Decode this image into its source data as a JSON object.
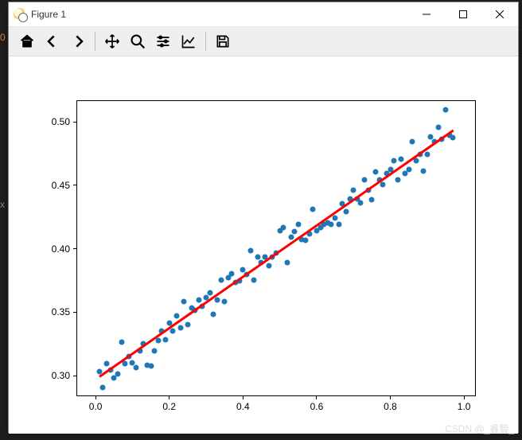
{
  "window": {
    "title": "Figure 1",
    "buttons": {
      "minimize": "Minimize",
      "maximize": "Maximize",
      "close": "Close"
    }
  },
  "toolbar": {
    "home": "Home",
    "back": "Back",
    "forward": "Forward",
    "pan": "Pan",
    "zoom": "Zoom",
    "configure": "Configure subplots",
    "edit": "Edit axis",
    "save": "Save figure"
  },
  "watermark": "CSDN @_睿智_",
  "chart_data": {
    "type": "scatter+line",
    "xlabel": "",
    "ylabel": "",
    "xlim": [
      -0.05,
      1.03
    ],
    "ylim": [
      0.285,
      0.517
    ],
    "xticks": [
      0.0,
      0.2,
      0.4,
      0.6,
      0.8,
      1.0
    ],
    "yticks": [
      0.3,
      0.35,
      0.4,
      0.45,
      0.5
    ],
    "line": {
      "x": [
        0.01,
        0.97
      ],
      "y": [
        0.3,
        0.494
      ],
      "color": "#ff0000"
    },
    "scatter": {
      "color": "#1f77b4",
      "points": [
        [
          0.01,
          0.304
        ],
        [
          0.02,
          0.291
        ],
        [
          0.03,
          0.31
        ],
        [
          0.04,
          0.305
        ],
        [
          0.05,
          0.299
        ],
        [
          0.06,
          0.302
        ],
        [
          0.07,
          0.327
        ],
        [
          0.08,
          0.31
        ],
        [
          0.09,
          0.316
        ],
        [
          0.1,
          0.311
        ],
        [
          0.11,
          0.307
        ],
        [
          0.12,
          0.32
        ],
        [
          0.13,
          0.326
        ],
        [
          0.14,
          0.309
        ],
        [
          0.15,
          0.308
        ],
        [
          0.16,
          0.32
        ],
        [
          0.17,
          0.328
        ],
        [
          0.18,
          0.336
        ],
        [
          0.19,
          0.329
        ],
        [
          0.2,
          0.342
        ],
        [
          0.21,
          0.336
        ],
        [
          0.22,
          0.348
        ],
        [
          0.23,
          0.338
        ],
        [
          0.24,
          0.359
        ],
        [
          0.25,
          0.341
        ],
        [
          0.26,
          0.354
        ],
        [
          0.27,
          0.352
        ],
        [
          0.28,
          0.36
        ],
        [
          0.29,
          0.355
        ],
        [
          0.3,
          0.362
        ],
        [
          0.31,
          0.366
        ],
        [
          0.32,
          0.349
        ],
        [
          0.33,
          0.36
        ],
        [
          0.34,
          0.376
        ],
        [
          0.35,
          0.359
        ],
        [
          0.36,
          0.378
        ],
        [
          0.37,
          0.381
        ],
        [
          0.38,
          0.374
        ],
        [
          0.39,
          0.375
        ],
        [
          0.4,
          0.384
        ],
        [
          0.41,
          0.38
        ],
        [
          0.42,
          0.399
        ],
        [
          0.43,
          0.376
        ],
        [
          0.44,
          0.394
        ],
        [
          0.45,
          0.39
        ],
        [
          0.46,
          0.394
        ],
        [
          0.47,
          0.387
        ],
        [
          0.48,
          0.394
        ],
        [
          0.49,
          0.397
        ],
        [
          0.5,
          0.415
        ],
        [
          0.51,
          0.417
        ],
        [
          0.52,
          0.39
        ],
        [
          0.53,
          0.41
        ],
        [
          0.54,
          0.414
        ],
        [
          0.55,
          0.42
        ],
        [
          0.56,
          0.408
        ],
        [
          0.57,
          0.407
        ],
        [
          0.58,
          0.412
        ],
        [
          0.59,
          0.432
        ],
        [
          0.6,
          0.415
        ],
        [
          0.61,
          0.417
        ],
        [
          0.62,
          0.42
        ],
        [
          0.63,
          0.421
        ],
        [
          0.64,
          0.42
        ],
        [
          0.65,
          0.425
        ],
        [
          0.66,
          0.42
        ],
        [
          0.67,
          0.436
        ],
        [
          0.68,
          0.43
        ],
        [
          0.69,
          0.44
        ],
        [
          0.7,
          0.447
        ],
        [
          0.71,
          0.44
        ],
        [
          0.72,
          0.437
        ],
        [
          0.73,
          0.455
        ],
        [
          0.74,
          0.447
        ],
        [
          0.75,
          0.439
        ],
        [
          0.76,
          0.461
        ],
        [
          0.77,
          0.455
        ],
        [
          0.78,
          0.451
        ],
        [
          0.79,
          0.46
        ],
        [
          0.8,
          0.463
        ],
        [
          0.81,
          0.47
        ],
        [
          0.82,
          0.455
        ],
        [
          0.83,
          0.471
        ],
        [
          0.84,
          0.46
        ],
        [
          0.85,
          0.463
        ],
        [
          0.86,
          0.485
        ],
        [
          0.87,
          0.47
        ],
        [
          0.88,
          0.475
        ],
        [
          0.89,
          0.462
        ],
        [
          0.9,
          0.475
        ],
        [
          0.91,
          0.489
        ],
        [
          0.92,
          0.485
        ],
        [
          0.93,
          0.496
        ],
        [
          0.94,
          0.487
        ],
        [
          0.95,
          0.51
        ],
        [
          0.96,
          0.49
        ],
        [
          0.97,
          0.488
        ]
      ]
    }
  }
}
